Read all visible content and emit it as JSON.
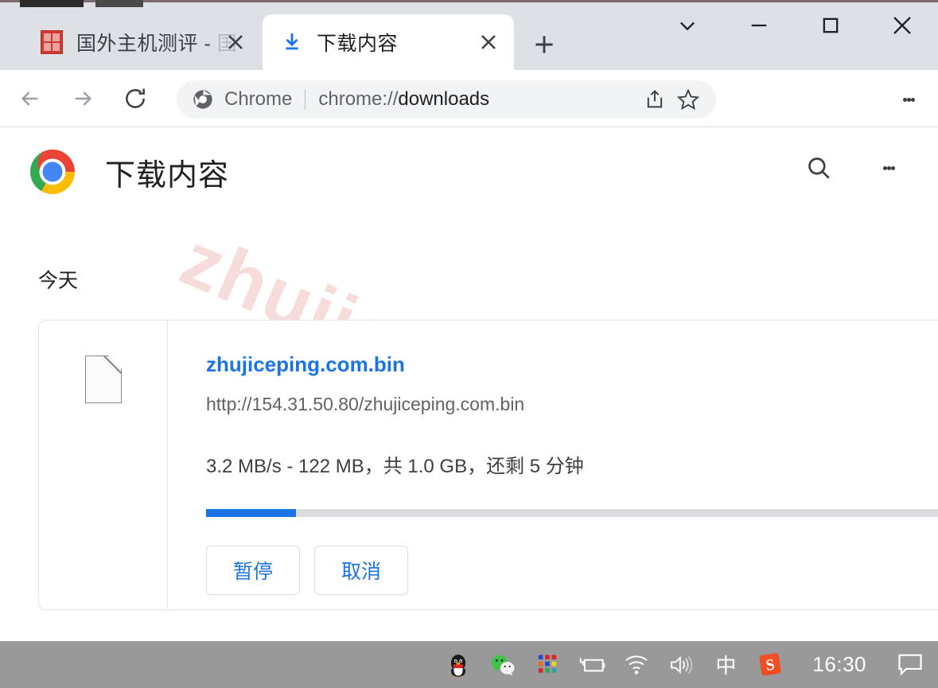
{
  "window": {
    "controls": [
      {
        "name": "tab-search",
        "glyph": "chevron-down"
      },
      {
        "name": "minimize",
        "glyph": "minus"
      },
      {
        "name": "maximize",
        "glyph": "square"
      },
      {
        "name": "close",
        "glyph": "cross"
      }
    ]
  },
  "tabs": [
    {
      "title": "国外主机测评 - ",
      "title_dim": "国",
      "favicon": "red-seal-icon",
      "active": false,
      "close_label": "×"
    },
    {
      "title": "下载内容",
      "favicon": "download-icon",
      "active": true,
      "close_label": "×"
    }
  ],
  "newtab_label": "+",
  "toolbar": {
    "back_icon": "back-arrow-icon",
    "forward_icon": "forward-arrow-icon",
    "reload_icon": "reload-icon",
    "omnibox": {
      "chip_icon": "chrome-icon",
      "chip_label": "Chrome",
      "url_scheme": "chrome://",
      "url_path": "downloads",
      "share_icon": "share-icon",
      "bookmark_icon": "star-icon"
    },
    "menu_icon": "three-dots-icon"
  },
  "page": {
    "logo": "chrome-logo",
    "title": "下载内容",
    "search_icon": "search-icon",
    "more_icon": "three-dots-icon",
    "day_group": "今天",
    "watermark": "zhujiceping.com"
  },
  "download": {
    "file_icon": "generic-file-icon",
    "file_name": "zhujiceping.com.bin",
    "url": "http://154.31.50.80/zhujiceping.com.bin",
    "status": "3.2 MB/s - 122 MB，共 1.0 GB，还剩 5 分钟",
    "speed": "3.2 MB/s",
    "downloaded": "122 MB",
    "total_size": "1.0 GB",
    "time_remaining": "5 分钟",
    "progress_percent": 12,
    "accent_color": "#1a73e8",
    "buttons": [
      {
        "label": "暂停",
        "name": "pause-button"
      },
      {
        "label": "取消",
        "name": "cancel-button"
      }
    ]
  },
  "taskbar": {
    "icons": [
      {
        "name": "qq-icon",
        "glyph": "🐧"
      },
      {
        "name": "wechat-icon",
        "glyph": "💬"
      },
      {
        "name": "tray-grid-icon",
        "glyph": "grid"
      },
      {
        "name": "battery-charging-icon",
        "glyph": "battery"
      },
      {
        "name": "wifi-icon",
        "glyph": "wifi"
      },
      {
        "name": "volume-icon",
        "glyph": "volume"
      },
      {
        "name": "ime-indicator",
        "glyph": "中"
      },
      {
        "name": "sogou-input-icon",
        "glyph": "S"
      }
    ],
    "clock": "16:30",
    "notification_icon": "notification-icon"
  }
}
